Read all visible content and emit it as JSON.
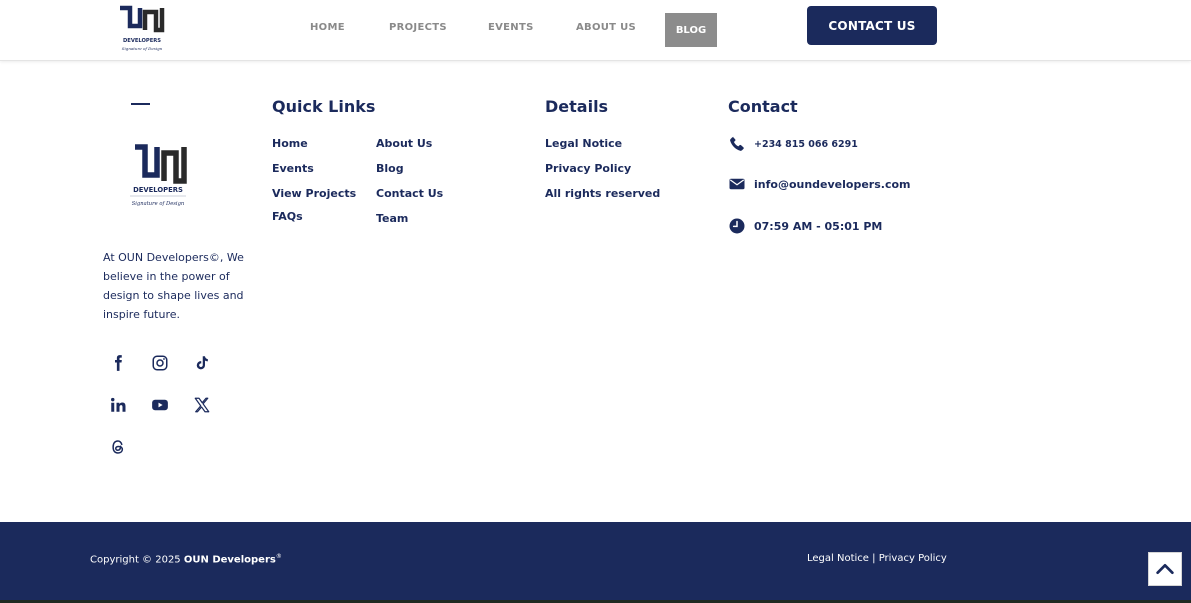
{
  "brand": {
    "logo_word": "DEVELOPERS",
    "logo_tagline": "Signature of Design",
    "navy": "#1b2a5c"
  },
  "nav": {
    "items": [
      "HOME",
      "PROJECTS",
      "EVENTS",
      "ABOUT US"
    ],
    "active_item": "BLOG",
    "cta_label": "CONTACT US"
  },
  "footer": {
    "about_text": "At OUN Developers©, We believe in the power of design to shape lives and inspire future.",
    "social_icons": [
      "facebook-icon",
      "instagram-icon",
      "tiktok-icon",
      "linkedin-icon",
      "youtube-icon",
      "x-icon",
      "threads-icon"
    ],
    "quick_links": {
      "title": "Quick Links",
      "col1": [
        "Home",
        "Events",
        "View Projects",
        "FAQs"
      ],
      "col2": [
        "About Us",
        "Blog",
        "Contact Us",
        "Team"
      ]
    },
    "details": {
      "title": "Details",
      "items": [
        "Legal Notice",
        "Privacy Policy",
        "All rights reserved"
      ]
    },
    "contact": {
      "title": "Contact",
      "phone": "+234 815 066 6291",
      "email": "info@oundevelopers.com",
      "hours": "07:59 AM - 05:01 PM"
    }
  },
  "bottom_bar": {
    "copyright_prefix": "Copyright © 2025",
    "company": "OUN Developers",
    "registered_mark": "®",
    "legal_notice": "Legal Notice",
    "separator": "|",
    "privacy_policy": "Privacy Policy"
  }
}
